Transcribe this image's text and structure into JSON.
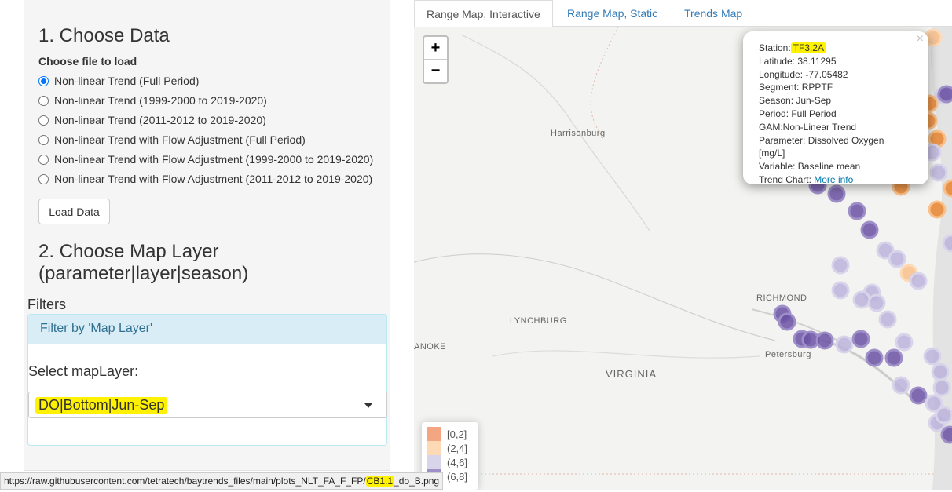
{
  "sidebar": {
    "step1_title": "1. Choose Data",
    "file_label": "Choose file to load",
    "options": [
      "Non-linear Trend (Full Period)",
      "Non-linear Trend (1999-2000 to 2019-2020)",
      "Non-linear Trend (2011-2012 to 2019-2020)",
      "Non-linear Trend with Flow Adjustment (Full Period)",
      "Non-linear Trend with Flow Adjustment (1999-2000 to 2019-2020)",
      "Non-linear Trend with Flow Adjustment (2011-2012 to 2019-2020)"
    ],
    "selected_index": 0,
    "load_button": "Load Data",
    "step2_title_line1": "2. Choose Map Layer",
    "step2_title_line2": "(parameter|layer|season)",
    "filters_title": "Filters",
    "filter_panel_title": "Filter by 'Map Layer'",
    "select_label": "Select mapLayer:",
    "select_value": "DO|Bottom|Jun-Sep"
  },
  "tabs": [
    "Range Map, Interactive",
    "Range Map, Static",
    "Trends Map"
  ],
  "active_tab": 0,
  "map": {
    "zoom_in": "+",
    "zoom_out": "−",
    "labels": {
      "harrisonburg": "Harrisonburg",
      "richmond": "RICHMOND",
      "lynchburg": "LYNCHBURG",
      "petersburg": "Petersburg",
      "virginia": "VIRGINIA",
      "anoke": "ANOKE"
    },
    "popup": {
      "close": "×",
      "station_label": "Station:",
      "station_value": "TF3.2A",
      "latitude": "Latitude: 38.11295",
      "longitude": "Longitude: -77.05482",
      "segment": "Segment: RPPTF",
      "season": "Season: Jun-Sep",
      "period": "Period: Full Period",
      "gam": "GAM:Non-Linear Trend",
      "parameter": "Parameter: Dissolved Oxygen [mg/L]",
      "variable": "Variable: Baseline mean",
      "trend_chart_label": "Trend Chart:",
      "trend_chart_link": "More info"
    },
    "legend": [
      {
        "label": "[0,2]",
        "color": "#f4a582"
      },
      {
        "label": "(2,4]",
        "color": "#fdd9b5"
      },
      {
        "label": "(4,6]",
        "color": "#d8d4ea"
      },
      {
        "label": "(6,8]",
        "color": "#9e8fc8"
      }
    ]
  },
  "status_bar": {
    "url_prefix": "https://raw.githubusercontent.com/tetratech/baytrends_files/main/plots_NLT_FA_F_FP/",
    "url_highlight": "CB1.1",
    "url_suffix": "_do_B.png"
  },
  "colors": {
    "orange": "#e8822e",
    "light_orange": "#f8c08a",
    "purple": "#6a51a3",
    "light_purple": "#bcb3dc",
    "highlight": "#fff200"
  }
}
